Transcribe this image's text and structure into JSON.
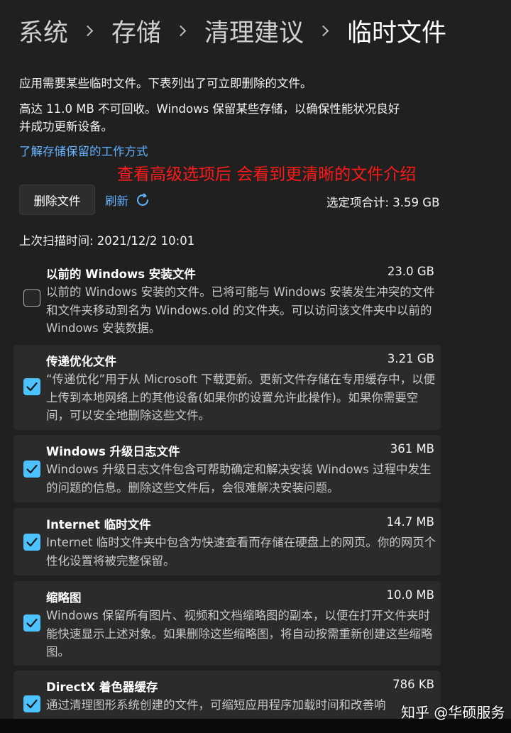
{
  "breadcrumb": {
    "items": [
      "系统",
      "存储",
      "清理建议",
      "临时文件"
    ]
  },
  "intro": {
    "line1": "应用需要某些临时文件。下表列出了可立即删除的文件。",
    "line2": "高达 11.0 MB 不可回收。Windows 保留某些存储，以确保性能状况良好",
    "line3": "并成功更新设备。",
    "link": "了解存储保留的工作方式"
  },
  "annotation": "查看高级选项后 会看到更清晰的文件介绍",
  "toolbar": {
    "delete_label": "删除文件",
    "refresh_label": "刷新",
    "selected_total": "选定项合计: 3.59 GB"
  },
  "last_scan": "上次扫描时间: 2021/12/2 10:01",
  "items": [
    {
      "title": "以前的 Windows 安装文件",
      "size": "23.0 GB",
      "checked": false,
      "description": "以前的 Windows 安装的文件。已将可能与 Windows 安装发生冲突的文件和文件夹移动到名为 Windows.old 的文件夹。可以访问该文件夹中以前的 Windows 安装数据。"
    },
    {
      "title": "传递优化文件",
      "size": "3.21 GB",
      "checked": true,
      "description": "“传递优化”用于从 Microsoft 下载更新。更新文件存储在专用缓存中，以便上传到本地网络上的其他设备(如果你的设置允许此操作)。如果你需要空间，可以安全地删除这些文件。"
    },
    {
      "title": "Windows 升级日志文件",
      "size": "361 MB",
      "checked": true,
      "description": "Windows 升级日志文件包含可帮助确定和解决安装 Windows 过程中发生的问题的信息。删除这些文件后，会很难解决安装问题。"
    },
    {
      "title": "Internet 临时文件",
      "size": "14.7 MB",
      "checked": true,
      "description": "Internet 临时文件夹中包含为快速查看而存储在硬盘上的网页。你的网页个性化设置将被完整保留。"
    },
    {
      "title": "缩略图",
      "size": "10.0 MB",
      "checked": true,
      "description": "Windows 保留所有图片、视频和文档缩略图的副本，以便在打开文件夹时能快速显示上述对象。如果删除这些缩略图，将自动按需重新创建这些缩略图。"
    },
    {
      "title": "DirectX 着色器缓存",
      "size": "786 KB",
      "checked": true,
      "description": "通过清理图形系统创建的文件，可缩短应用程序加载时间和改善响"
    }
  ],
  "watermark": "知乎 @华硕服务",
  "colors": {
    "background": "#202020",
    "card": "#2b2b2b",
    "accent": "#4cc2ff",
    "link": "#63b2ff",
    "annotation": "#ff1a1a"
  },
  "icons": {
    "breadcrumb_separator": "chevron-right-icon",
    "refresh": "refresh-icon",
    "checkbox_checked": "checkmark-icon"
  }
}
